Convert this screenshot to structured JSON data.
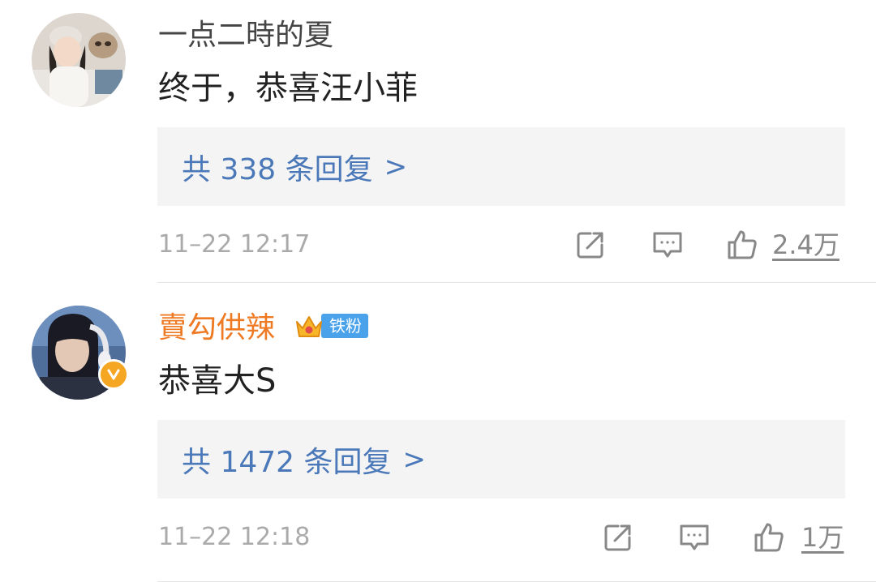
{
  "comments": [
    {
      "username": "一点二時的夏",
      "text": "终于，恭喜汪小菲",
      "replies_label": "共 338 条回复",
      "replies_arrow": ">",
      "time": "11–22 12:17",
      "likes": "2.4万"
    },
    {
      "username": "賣勾供辣",
      "fan_badge": "铁粉",
      "text": "恭喜大S",
      "replies_label": "共 1472 条回复",
      "replies_arrow": ">",
      "time": "11–22 12:18",
      "likes": "1万"
    }
  ],
  "colors": {
    "username_highlight": "#ee7a24",
    "reply_link": "#4a78b8",
    "reply_bg": "#f4f4f4",
    "meta_gray": "#aaaaaa",
    "verified": "#f5a623",
    "fan_badge": "#4aa3ea"
  },
  "icons": [
    "share-icon",
    "comment-icon",
    "like-icon",
    "verified-icon",
    "crown-icon"
  ]
}
